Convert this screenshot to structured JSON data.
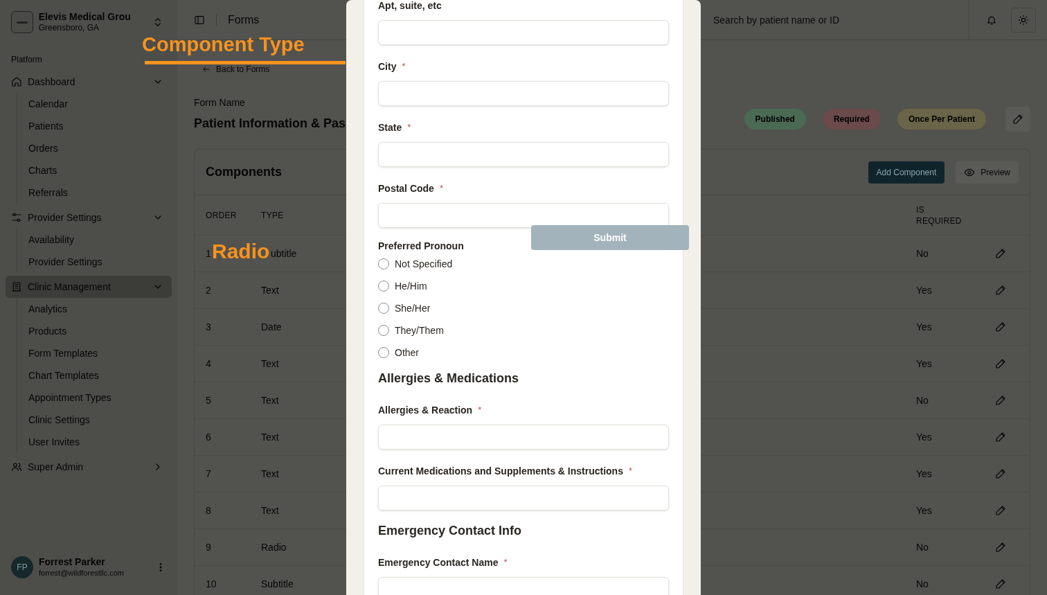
{
  "sidebar": {
    "org": {
      "name": "Elevis Medical Grou",
      "location": "Greensboro, GA"
    },
    "section_label": "Platform",
    "groups": [
      {
        "label": "Dashboard",
        "expanded": true,
        "selected": false,
        "children": [
          "Calendar",
          "Patients",
          "Orders",
          "Charts",
          "Referrals"
        ]
      },
      {
        "label": "Provider Settings",
        "expanded": true,
        "selected": false,
        "children": [
          "Availability",
          "Provider Settings"
        ]
      },
      {
        "label": "Clinic Management",
        "expanded": true,
        "selected": true,
        "children": [
          "Analytics",
          "Products",
          "Form Templates",
          "Chart Templates",
          "Appointment Types",
          "Clinic Settings",
          "User Invites"
        ]
      },
      {
        "label": "Super Admin",
        "expanded": false,
        "selected": false
      }
    ],
    "user": {
      "initials": "FP",
      "name": "Forrest Parker",
      "email": "forrest@wildforestllc.com"
    }
  },
  "header": {
    "title": "Forms",
    "search": {
      "placeholder": "Search by patient name or ID"
    }
  },
  "page": {
    "back_link": "Back to Forms",
    "form_name_label": "Form Name",
    "form_name": "Patient Information & Pas",
    "badges": [
      {
        "label": "Published",
        "color": "#4a6a54"
      },
      {
        "label": "Required",
        "color": "#6a4a4a"
      },
      {
        "label": "Once Per Patient",
        "color": "#6a6448"
      }
    ]
  },
  "components": {
    "title": "Components",
    "buttons": [
      {
        "label": "Add Component",
        "kind": "primary"
      },
      {
        "label": "Preview",
        "kind": "secondary"
      }
    ],
    "columns": [
      "ORDER",
      "TYPE",
      "IS REQUIRED"
    ],
    "rows": [
      {
        "order": "1",
        "type": "ubtitle",
        "required": "No"
      },
      {
        "order": "2",
        "type": "Text",
        "required": "Yes"
      },
      {
        "order": "3",
        "type": "Date",
        "required": "Yes"
      },
      {
        "order": "4",
        "type": "Text",
        "required": "Yes"
      },
      {
        "order": "5",
        "type": "Text",
        "required": "No"
      },
      {
        "order": "6",
        "type": "Text",
        "required": "Yes"
      },
      {
        "order": "7",
        "type": "Text",
        "required": "Yes"
      },
      {
        "order": "8",
        "type": "Text",
        "required": "Yes"
      },
      {
        "order": "9",
        "type": "Radio",
        "required": "No"
      },
      {
        "order": "10",
        "type": "Subtitle",
        "required": "No"
      }
    ]
  },
  "preview_modal": {
    "items": [
      {
        "kind": "field",
        "label": "Apt, suite, etc",
        "required": false
      },
      {
        "kind": "field",
        "label": "City",
        "required": true
      },
      {
        "kind": "field",
        "label": "State",
        "required": true
      },
      {
        "kind": "field",
        "label": "Postal Code",
        "required": true
      },
      {
        "kind": "radio",
        "label": "Preferred Pronoun",
        "options": [
          {
            "label": "Not Specified",
            "selected": false
          },
          {
            "label": "He/Him",
            "selected": false
          },
          {
            "label": "She/Her",
            "selected": false
          },
          {
            "label": "They/Them",
            "selected": false
          },
          {
            "label": "Other",
            "selected": false
          }
        ]
      },
      {
        "kind": "heading",
        "label": "Allergies & Medications"
      },
      {
        "kind": "field",
        "label": "Allergies & Reaction",
        "required": true
      },
      {
        "kind": "field",
        "label": "Current Medications and Supplements & Instructions",
        "required": true
      },
      {
        "kind": "heading",
        "label": "Emergency Contact Info"
      },
      {
        "kind": "field",
        "label": "Emergency Contact Name",
        "required": true
      }
    ],
    "submit": "Submit",
    "required_mark": "*"
  },
  "annotations": [
    {
      "text": "Component Type",
      "underline": true
    },
    {
      "text": "Radio",
      "underline": false
    }
  ]
}
